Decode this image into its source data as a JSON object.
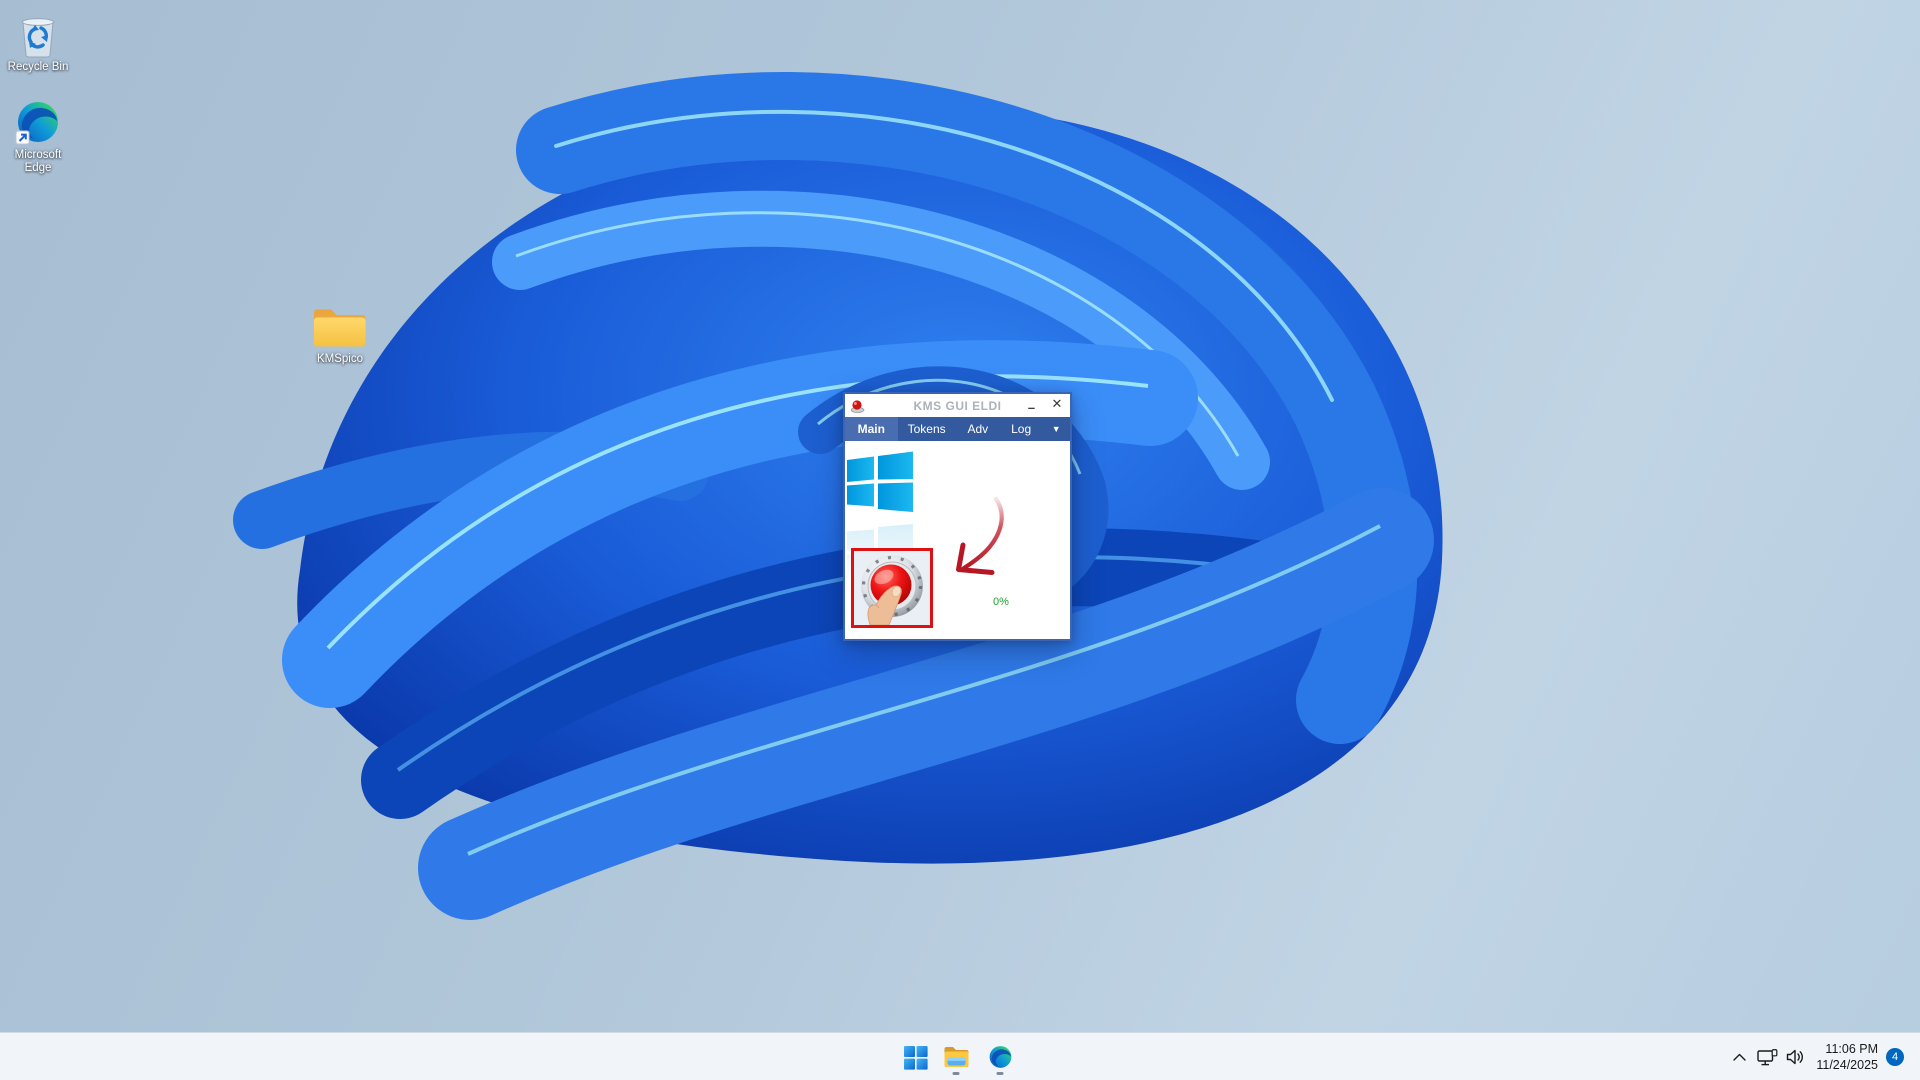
{
  "wallpaper": {
    "name": "windows-11-blue-bloom",
    "base_colors": [
      "#a9bfd6",
      "#0b3fb4",
      "#2f80ee",
      "#9fe6f8"
    ]
  },
  "desktop_icons": [
    {
      "label": "Recycle Bin",
      "icon": "recycle-bin-icon"
    },
    {
      "label": "Microsoft Edge",
      "icon": "edge-icon"
    },
    {
      "label": "KMSpico",
      "icon": "folder-icon"
    }
  ],
  "window": {
    "title": "KMS GUI ELDI",
    "icon": "red-button-icon",
    "controls": {
      "minimize": "–",
      "close": "✕"
    },
    "tabs": [
      {
        "label": "Main",
        "active": true
      },
      {
        "label": "Tokens",
        "active": false
      },
      {
        "label": "Adv",
        "active": false
      },
      {
        "label": "Log",
        "active": false
      }
    ],
    "dropdown_icon": "▼",
    "content": {
      "windows_logo": "windows-logo-with-reflection",
      "activation_button": "red-push-button-with-finger",
      "annotation_arrow": "hand-drawn-red-arrow",
      "progress": "0%"
    },
    "colors": {
      "tab_bar": "#33599f",
      "tab_active": "#4a6cb0",
      "highlight_border": "#dd1111",
      "arrow": "#c41d2d",
      "progress_text": "#1fa32b"
    }
  },
  "taskbar": {
    "buttons": [
      {
        "name": "Start",
        "icon": "windows-start-icon",
        "running": false
      },
      {
        "name": "File Explorer",
        "icon": "file-explorer-icon",
        "running": true
      },
      {
        "name": "Microsoft Edge",
        "icon": "edge-icon",
        "running": true
      }
    ],
    "tray": {
      "hidden_icons_icon": "chevron-up-icon",
      "network_icon": "network-icon",
      "volume_icon": "speaker-icon",
      "time": "11:06 PM",
      "date": "11/24/2025",
      "notification_count": "4"
    }
  }
}
